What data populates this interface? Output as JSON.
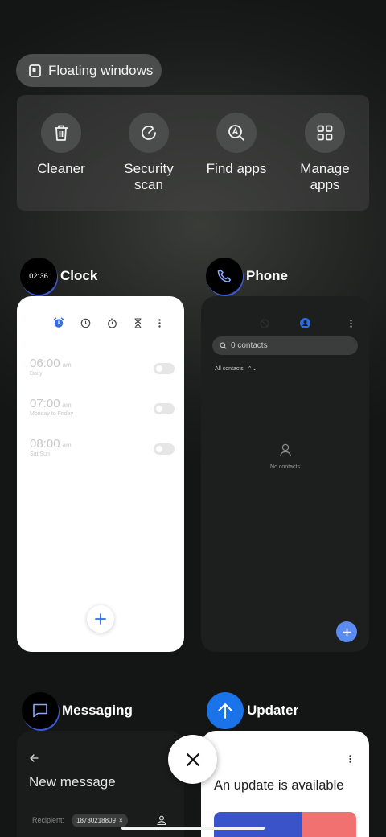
{
  "floating_windows": {
    "label": "Floating windows",
    "icon": "floating-window-icon"
  },
  "quick_actions": [
    {
      "id": "cleaner",
      "label": "Cleaner",
      "icon": "trash-icon"
    },
    {
      "id": "security",
      "label": "Security scan",
      "icon": "security-scan-icon"
    },
    {
      "id": "findapps",
      "label": "Find apps",
      "icon": "find-apps-icon"
    },
    {
      "id": "manage",
      "label": "Manage apps",
      "icon": "grid-icon"
    }
  ],
  "apps": {
    "clock": {
      "name": "Clock",
      "icon_time": "02:36",
      "alarms": [
        {
          "time": "06:00",
          "ampm": "am",
          "repeat": "Daily"
        },
        {
          "time": "07:00",
          "ampm": "am",
          "repeat": "Monday to Friday"
        },
        {
          "time": "08:00",
          "ampm": "am",
          "repeat": "Sat,Sun"
        }
      ]
    },
    "phone": {
      "name": "Phone",
      "search_placeholder": "0 contacts",
      "filter_label": "All contacts",
      "empty_text": "No contacts"
    },
    "messaging": {
      "name": "Messaging",
      "title": "New message",
      "recipient_label": "Recipient:",
      "recipient_number": "18730218809"
    },
    "updater": {
      "name": "Updater",
      "message": "An update is available"
    }
  },
  "colors": {
    "accent_blue": "#2f6ce5",
    "updater_blue": "#1a73e8"
  }
}
